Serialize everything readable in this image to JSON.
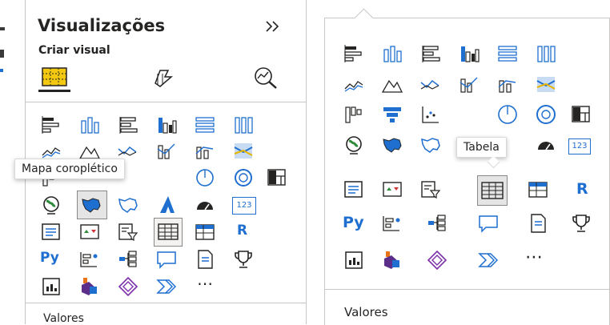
{
  "left": {
    "title": "Visualizações",
    "expand_icon": "double-chevron-right-icon",
    "section_label": "Criar visual",
    "tooltip": "Mapa coroplético",
    "bottom_label": "Valores",
    "selected_icon": "filled-map-icon"
  },
  "right": {
    "tooltip": "Tabela",
    "bottom_label": "Valores",
    "selected_icon": "table-icon"
  },
  "colors": {
    "accent_blue": "#1f6fd0",
    "accent_yellow": "#e8b500",
    "selected_bg": "#e5e5e5",
    "border": "#c8c6c4"
  },
  "icons": {
    "ellipsis": "⋯",
    "python": "Py",
    "r": "R",
    "card": "123"
  }
}
